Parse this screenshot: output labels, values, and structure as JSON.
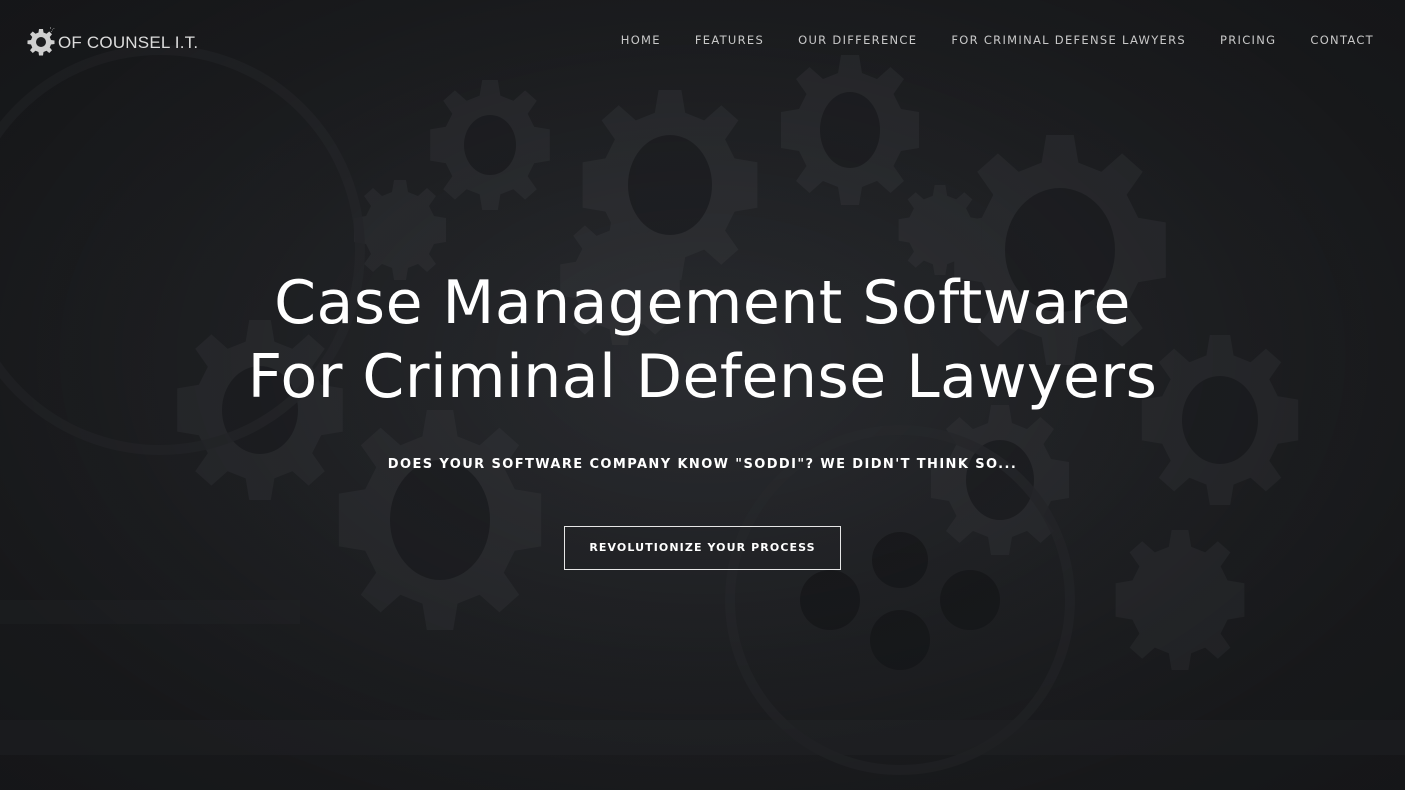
{
  "brand": {
    "name": "OF COUNSEL I.T.",
    "logo_icon": "gear-icon"
  },
  "nav": {
    "items": [
      {
        "label": "HOME"
      },
      {
        "label": "FEATURES"
      },
      {
        "label": "OUR DIFFERENCE"
      },
      {
        "label": "FOR CRIMINAL DEFENSE LAWYERS"
      },
      {
        "label": "PRICING"
      },
      {
        "label": "CONTACT"
      }
    ]
  },
  "hero": {
    "title_line1": "Case Management Software",
    "title_line2": "For Criminal Defense Lawyers",
    "subtitle": "DOES YOUR SOFTWARE COMPANY KNOW \"SODDI\"? WE DIDN'T THINK SO...",
    "cta_label": "REVOLUTIONIZE YOUR PROCESS"
  },
  "colors": {
    "background": "#202225",
    "text": "#ffffff",
    "nav_text": "#c9c9c9"
  }
}
